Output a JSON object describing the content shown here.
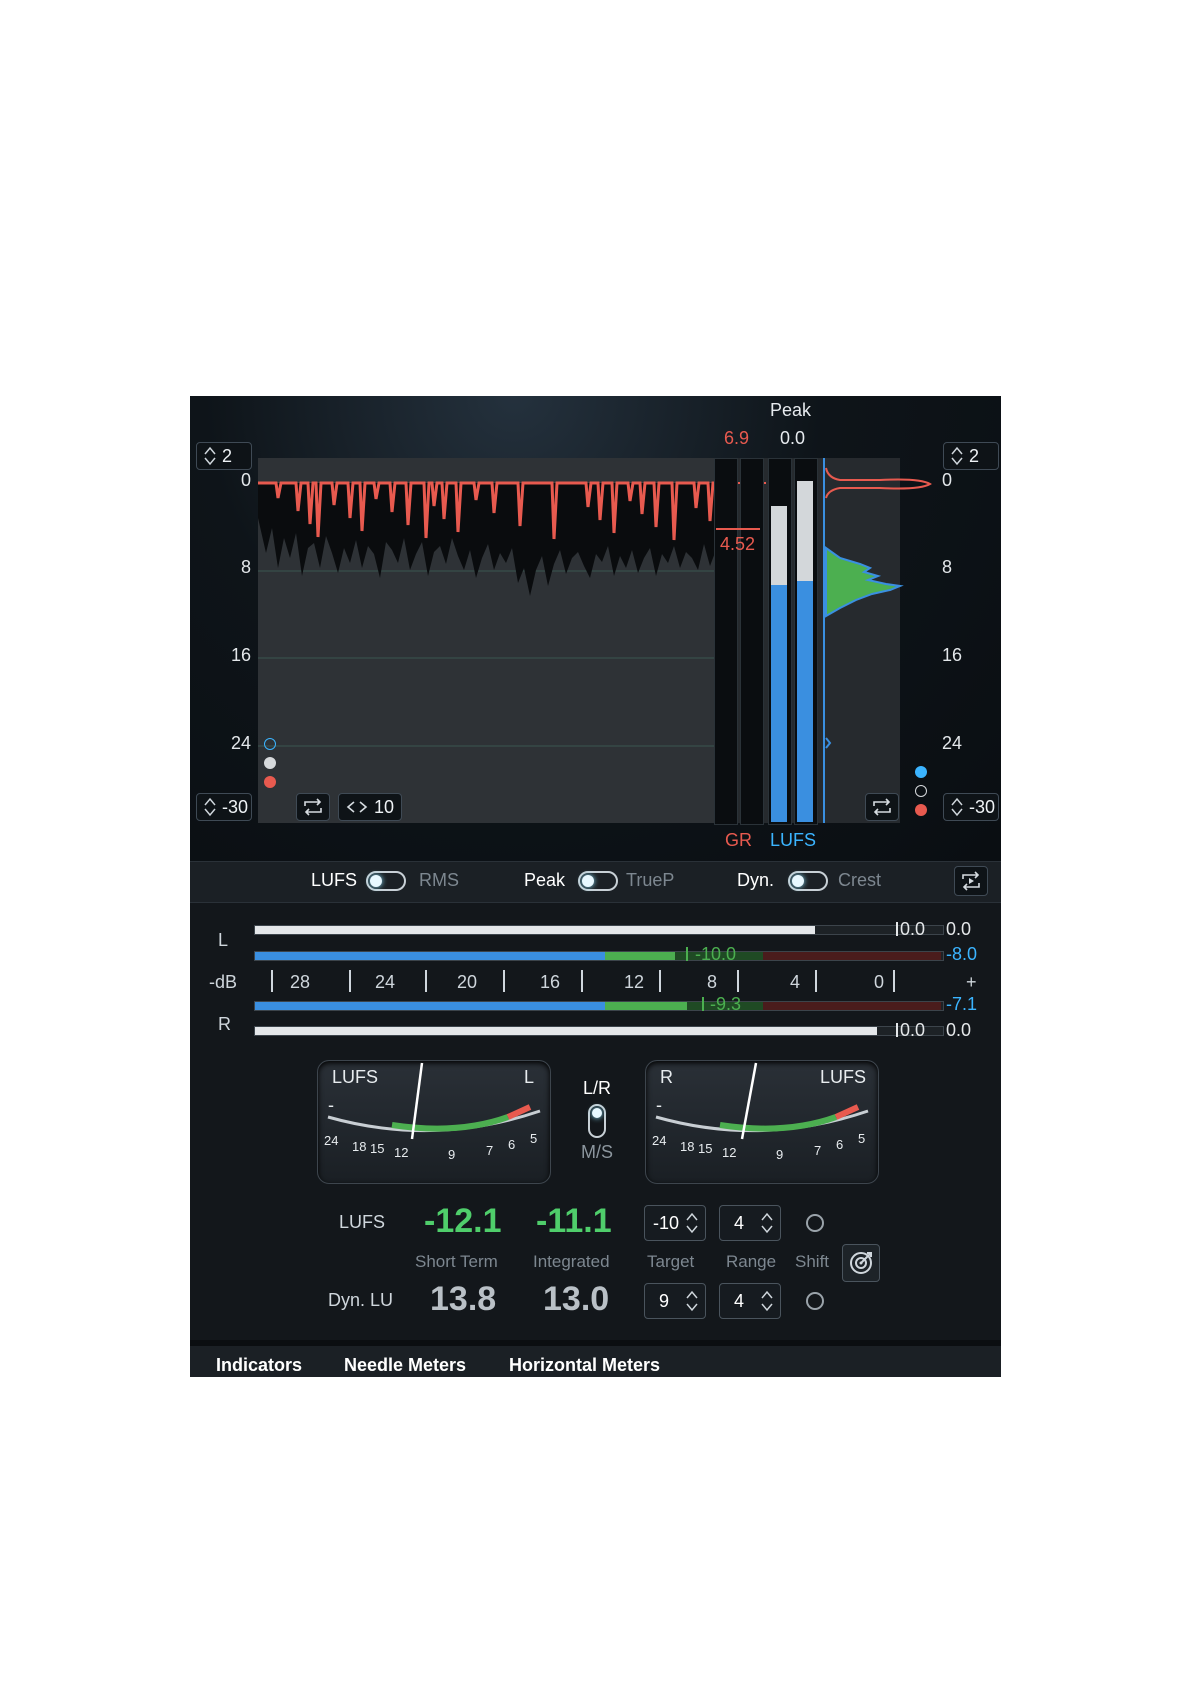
{
  "colors": {
    "accent_blue": "#3a8fe0",
    "gr_red": "#e85a4f",
    "green": "#4caf50",
    "text_light": "#d8dde2",
    "text_dim": "#7d8790",
    "cyan_value": "#3bb4ff"
  },
  "top": {
    "left_top_stepper": "2",
    "left_bottom_stepper": "-30",
    "right_top_stepper": "2",
    "right_bottom_stepper": "-30",
    "time_window": "10",
    "axis_left": [
      "0",
      "8",
      "16",
      "24"
    ],
    "axis_right": [
      "0",
      "8",
      "16",
      "24"
    ],
    "peak_header": "Peak",
    "gr_value": "6.9",
    "peak_value": "0.0",
    "gr_mid_value": "4.52",
    "gr_label": "GR",
    "lufs_label": "LUFS",
    "lufs_bar_level": 0.66,
    "peak_bar_level": 0.88,
    "lufs_bar2_level": 0.67,
    "peak_bar2_level": 0.95
  },
  "mode_row": {
    "lufs": "LUFS",
    "rms": "RMS",
    "peak": "Peak",
    "truep": "TrueP",
    "dyn": "Dyn.",
    "crest": "Crest"
  },
  "meters": {
    "L_label": "L",
    "R_label": "R",
    "db_label": "-dB",
    "plus_label": "+",
    "scale": [
      "28",
      "24",
      "20",
      "16",
      "12",
      "8",
      "4",
      "0"
    ],
    "L_peak_marker": "0.0",
    "L_peak_value": "0.0",
    "L_lufs_marker": "-10.0",
    "L_lufs_value": "-8.0",
    "R_lufs_marker": "-9.3",
    "R_lufs_value": "-7.1",
    "R_peak_marker": "0.0",
    "R_peak_value": "0.0"
  },
  "needles": {
    "left_title": "LUFS",
    "left_channel": "L",
    "right_channel": "R",
    "right_title": "LUFS",
    "minus": "-",
    "scale": [
      "24",
      "18",
      "15",
      "12",
      "9",
      "7",
      "6",
      "5"
    ],
    "lr": "L/R",
    "ms": "M/S"
  },
  "stats": {
    "lufs_label": "LUFS",
    "short_term_value": "-12.1",
    "integrated_value": "-11.1",
    "short_term_label": "Short Term",
    "integrated_label": "Integrated",
    "target_value": "-10",
    "range_value": "4",
    "target_label": "Target",
    "range_label": "Range",
    "shift_label": "Shift",
    "dyn_label": "Dyn. LU",
    "dyn_short_value": "13.8",
    "dyn_integrated_value": "13.0",
    "dyn_target_value": "9",
    "dyn_range_value": "4"
  },
  "tabs": [
    "Indicators",
    "Needle Meters",
    "Horizontal Meters"
  ]
}
